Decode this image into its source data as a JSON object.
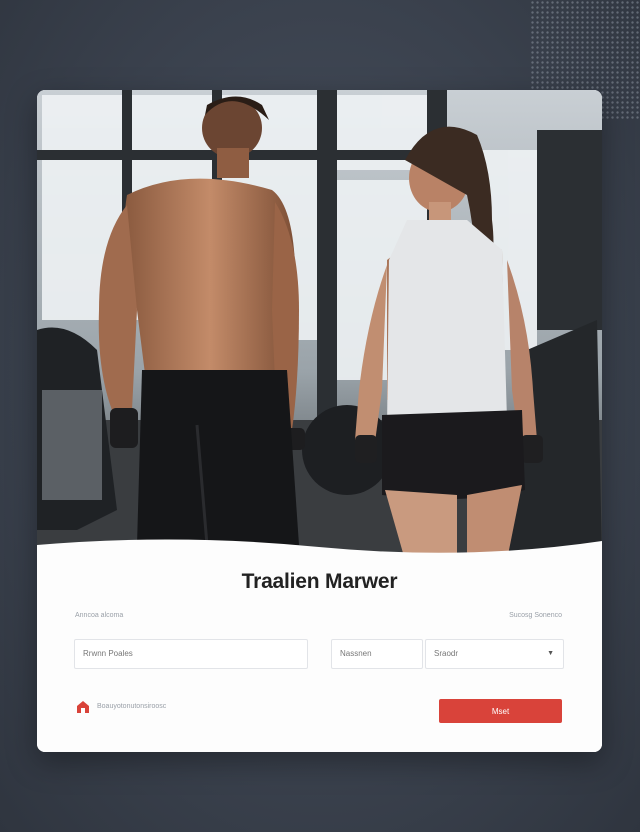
{
  "title": "Traalien Marwer",
  "labels": {
    "left": "Anncoa alcoma",
    "right": "Sucosg Sonenco"
  },
  "fields": {
    "name_value": "Rrwnn Poales",
    "mid_value": "Nassnen",
    "select_value": "Sraodr"
  },
  "remember_label": "Boauyotonutonsiroosc",
  "submit_label": "Mset",
  "colors": {
    "accent": "#d9433a"
  },
  "icons": {
    "remember": "home-icon",
    "select": "chevron-down-icon"
  }
}
